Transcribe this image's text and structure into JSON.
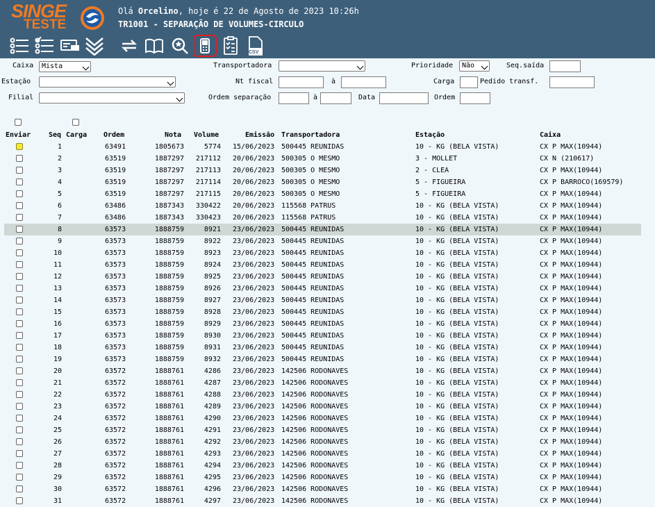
{
  "header": {
    "logo_name": "SINGE",
    "logo_sub": "TESTE",
    "greeting_prefix": "Olá",
    "user": "Orcelino",
    "greeting_suffix": ", hoje é 22 de Agosto de 2023 10:26h",
    "screen_title": "TR1001 - SEPARAÇÃO DE VOLUMES-CIRCULO",
    "brand_color": "#f07a22",
    "bar_color": "#3d5f7a"
  },
  "toolbar": {
    "icons": [
      "list-icon",
      "checklist-icon",
      "card-icon",
      "chevrons-down-icon",
      "refresh-icon",
      "book-icon",
      "search-star-icon",
      "handheld-device-icon",
      "task-list-icon",
      "csv-icon"
    ],
    "csv_label": "CSV"
  },
  "filters": {
    "caixa_label": "Caixa",
    "caixa_value": "Mista",
    "estacao_label": "Estação",
    "estacao_value": "",
    "filial_label": "Filial",
    "filial_value": "",
    "transportadora_label": "Transportadora",
    "transportadora_value": "",
    "nt_fiscal_label": "Nt fiscal",
    "a_label": "à",
    "ordem_separacao_label": "Ordem separação",
    "data_label": "Data",
    "ordem_label": "Ordem",
    "prioridade_label": "Prioridade",
    "prioridade_value": "Não",
    "seq_saida_label": "Seq.saída",
    "carga_label": "Carga",
    "pedido_transf_label": "Pedido transf."
  },
  "table": {
    "headers": {
      "enviar": "Enviar",
      "seq": "Seq",
      "carga": "Carga",
      "ordem": "Ordem",
      "nota": "Nota",
      "volume": "Volume",
      "emissao": "Emissão",
      "transportadora": "Transportadora",
      "estacao": "Estação",
      "caixa": "Caixa"
    },
    "rows": [
      {
        "seq": "1",
        "ordem": "63491",
        "nota": "1805673",
        "volume": "5774",
        "emissao": "15/06/2023",
        "transp": "500445 REUNIDAS",
        "estacao": "10 - KG (BELA VISTA)",
        "caixa": "CX P MAX(10944)"
      },
      {
        "seq": "2",
        "ordem": "63519",
        "nota": "1887297",
        "volume": "217112",
        "emissao": "20/06/2023",
        "transp": "500305 O MESMO",
        "estacao": "3 - MOLLET",
        "caixa": "CX N (210617)"
      },
      {
        "seq": "3",
        "ordem": "63519",
        "nota": "1887297",
        "volume": "217113",
        "emissao": "20/06/2023",
        "transp": "500305 O MESMO",
        "estacao": "2 - CLEA",
        "caixa": "CX P MAX(10944)"
      },
      {
        "seq": "4",
        "ordem": "63519",
        "nota": "1887297",
        "volume": "217114",
        "emissao": "20/06/2023",
        "transp": "500305 O MESMO",
        "estacao": "5 - FIGUEIRA",
        "caixa": "CX P BARROCO(169579)"
      },
      {
        "seq": "5",
        "ordem": "63519",
        "nota": "1887297",
        "volume": "217115",
        "emissao": "20/06/2023",
        "transp": "500305 O MESMO",
        "estacao": "5 - FIGUEIRA",
        "caixa": "CX P MAX(10944)"
      },
      {
        "seq": "6",
        "ordem": "63486",
        "nota": "1887343",
        "volume": "330422",
        "emissao": "20/06/2023",
        "transp": "115568 PATRUS",
        "estacao": "10 - KG (BELA VISTA)",
        "caixa": "CX P MAX(10944)"
      },
      {
        "seq": "7",
        "ordem": "63486",
        "nota": "1887343",
        "volume": "330423",
        "emissao": "20/06/2023",
        "transp": "115568 PATRUS",
        "estacao": "10 - KG (BELA VISTA)",
        "caixa": "CX P MAX(10944)"
      },
      {
        "seq": "8",
        "ordem": "63573",
        "nota": "1888759",
        "volume": "8921",
        "emissao": "23/06/2023",
        "transp": "500445 REUNIDAS",
        "estacao": "10 - KG (BELA VISTA)",
        "caixa": "CX P MAX(10944)"
      },
      {
        "seq": "9",
        "ordem": "63573",
        "nota": "1888759",
        "volume": "8922",
        "emissao": "23/06/2023",
        "transp": "500445 REUNIDAS",
        "estacao": "10 - KG (BELA VISTA)",
        "caixa": "CX P MAX(10944)"
      },
      {
        "seq": "10",
        "ordem": "63573",
        "nota": "1888759",
        "volume": "8923",
        "emissao": "23/06/2023",
        "transp": "500445 REUNIDAS",
        "estacao": "10 - KG (BELA VISTA)",
        "caixa": "CX P MAX(10944)"
      },
      {
        "seq": "11",
        "ordem": "63573",
        "nota": "1888759",
        "volume": "8924",
        "emissao": "23/06/2023",
        "transp": "500445 REUNIDAS",
        "estacao": "10 - KG (BELA VISTA)",
        "caixa": "CX P MAX(10944)"
      },
      {
        "seq": "12",
        "ordem": "63573",
        "nota": "1888759",
        "volume": "8925",
        "emissao": "23/06/2023",
        "transp": "500445 REUNIDAS",
        "estacao": "10 - KG (BELA VISTA)",
        "caixa": "CX P MAX(10944)"
      },
      {
        "seq": "13",
        "ordem": "63573",
        "nota": "1888759",
        "volume": "8926",
        "emissao": "23/06/2023",
        "transp": "500445 REUNIDAS",
        "estacao": "10 - KG (BELA VISTA)",
        "caixa": "CX P MAX(10944)"
      },
      {
        "seq": "14",
        "ordem": "63573",
        "nota": "1888759",
        "volume": "8927",
        "emissao": "23/06/2023",
        "transp": "500445 REUNIDAS",
        "estacao": "10 - KG (BELA VISTA)",
        "caixa": "CX P MAX(10944)"
      },
      {
        "seq": "15",
        "ordem": "63573",
        "nota": "1888759",
        "volume": "8928",
        "emissao": "23/06/2023",
        "transp": "500445 REUNIDAS",
        "estacao": "10 - KG (BELA VISTA)",
        "caixa": "CX P MAX(10944)"
      },
      {
        "seq": "16",
        "ordem": "63573",
        "nota": "1888759",
        "volume": "8929",
        "emissao": "23/06/2023",
        "transp": "500445 REUNIDAS",
        "estacao": "10 - KG (BELA VISTA)",
        "caixa": "CX P MAX(10944)"
      },
      {
        "seq": "17",
        "ordem": "63573",
        "nota": "1888759",
        "volume": "8930",
        "emissao": "23/06/2023",
        "transp": "500445 REUNIDAS",
        "estacao": "10 - KG (BELA VISTA)",
        "caixa": "CX P MAX(10944)"
      },
      {
        "seq": "18",
        "ordem": "63573",
        "nota": "1888759",
        "volume": "8931",
        "emissao": "23/06/2023",
        "transp": "500445 REUNIDAS",
        "estacao": "10 - KG (BELA VISTA)",
        "caixa": "CX P MAX(10944)"
      },
      {
        "seq": "19",
        "ordem": "63573",
        "nota": "1888759",
        "volume": "8932",
        "emissao": "23/06/2023",
        "transp": "500445 REUNIDAS",
        "estacao": "10 - KG (BELA VISTA)",
        "caixa": "CX P MAX(10944)"
      },
      {
        "seq": "20",
        "ordem": "63572",
        "nota": "1888761",
        "volume": "4286",
        "emissao": "23/06/2023",
        "transp": "142506 RODONAVES",
        "estacao": "10 - KG (BELA VISTA)",
        "caixa": "CX P MAX(10944)"
      },
      {
        "seq": "21",
        "ordem": "63572",
        "nota": "1888761",
        "volume": "4287",
        "emissao": "23/06/2023",
        "transp": "142506 RODONAVES",
        "estacao": "10 - KG (BELA VISTA)",
        "caixa": "CX P MAX(10944)"
      },
      {
        "seq": "22",
        "ordem": "63572",
        "nota": "1888761",
        "volume": "4288",
        "emissao": "23/06/2023",
        "transp": "142506 RODONAVES",
        "estacao": "10 - KG (BELA VISTA)",
        "caixa": "CX P MAX(10944)"
      },
      {
        "seq": "23",
        "ordem": "63572",
        "nota": "1888761",
        "volume": "4289",
        "emissao": "23/06/2023",
        "transp": "142506 RODONAVES",
        "estacao": "10 - KG (BELA VISTA)",
        "caixa": "CX P MAX(10944)"
      },
      {
        "seq": "24",
        "ordem": "63572",
        "nota": "1888761",
        "volume": "4290",
        "emissao": "23/06/2023",
        "transp": "142506 RODONAVES",
        "estacao": "10 - KG (BELA VISTA)",
        "caixa": "CX P MAX(10944)"
      },
      {
        "seq": "25",
        "ordem": "63572",
        "nota": "1888761",
        "volume": "4291",
        "emissao": "23/06/2023",
        "transp": "142506 RODONAVES",
        "estacao": "10 - KG (BELA VISTA)",
        "caixa": "CX P MAX(10944)"
      },
      {
        "seq": "26",
        "ordem": "63572",
        "nota": "1888761",
        "volume": "4292",
        "emissao": "23/06/2023",
        "transp": "142506 RODONAVES",
        "estacao": "10 - KG (BELA VISTA)",
        "caixa": "CX P MAX(10944)"
      },
      {
        "seq": "27",
        "ordem": "63572",
        "nota": "1888761",
        "volume": "4293",
        "emissao": "23/06/2023",
        "transp": "142506 RODONAVES",
        "estacao": "10 - KG (BELA VISTA)",
        "caixa": "CX P MAX(10944)"
      },
      {
        "seq": "28",
        "ordem": "63572",
        "nota": "1888761",
        "volume": "4294",
        "emissao": "23/06/2023",
        "transp": "142506 RODONAVES",
        "estacao": "10 - KG (BELA VISTA)",
        "caixa": "CX P MAX(10944)"
      },
      {
        "seq": "29",
        "ordem": "63572",
        "nota": "1888761",
        "volume": "4295",
        "emissao": "23/06/2023",
        "transp": "142506 RODONAVES",
        "estacao": "10 - KG (BELA VISTA)",
        "caixa": "CX P MAX(10944)"
      },
      {
        "seq": "30",
        "ordem": "63572",
        "nota": "1888761",
        "volume": "4296",
        "emissao": "23/06/2023",
        "transp": "142506 RODONAVES",
        "estacao": "10 - KG (BELA VISTA)",
        "caixa": "CX P MAX(10944)"
      },
      {
        "seq": "31",
        "ordem": "63572",
        "nota": "1888761",
        "volume": "4297",
        "emissao": "23/06/2023",
        "transp": "142506 RODONAVES",
        "estacao": "10 - KG (BELA VISTA)",
        "caixa": "CX P MAX(10944)"
      }
    ]
  }
}
